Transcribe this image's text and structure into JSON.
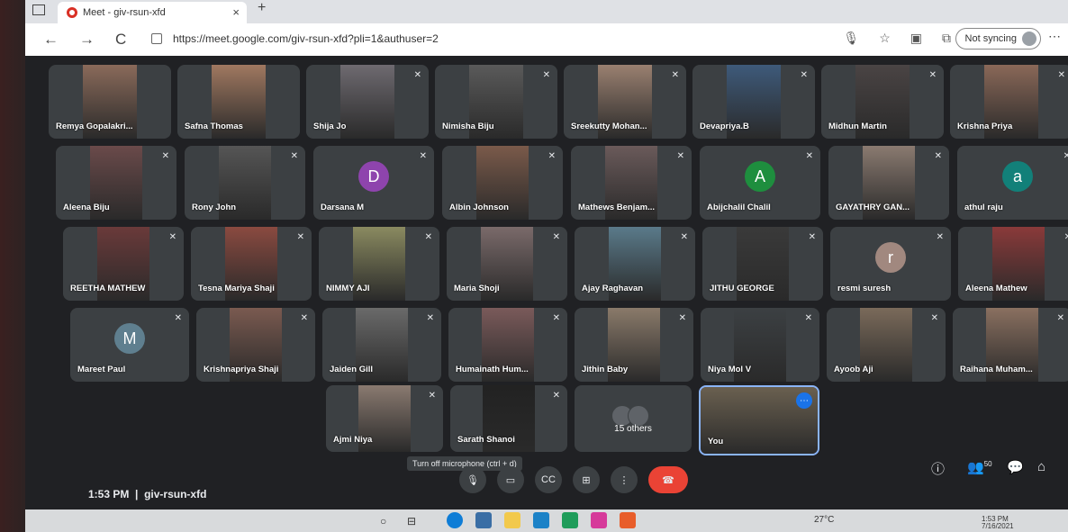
{
  "browser": {
    "tab_title": "Meet - giv-rsun-xfd",
    "tab_close": "×",
    "new_tab": "+",
    "url": "https://meet.google.com/giv-rsun-xfd?pli=1&authuser=2",
    "sync_label": "Not syncing",
    "back": "←",
    "forward": "→",
    "reload": "C"
  },
  "participants": [
    {
      "name": "Remya Gopalakri...",
      "muted": false,
      "photo": "#8a6a5a"
    },
    {
      "name": "Safna Thomas",
      "muted": false,
      "photo": "#a07860"
    },
    {
      "name": "Shija Jo",
      "muted": true,
      "photo": "#6e6a70"
    },
    {
      "name": "Nimisha Biju",
      "muted": true,
      "photo": "#5a5a5a"
    },
    {
      "name": "Sreekutty Mohan...",
      "muted": true,
      "photo": "#9a8070"
    },
    {
      "name": "Devapriya.B",
      "muted": true,
      "photo": "#3e5a7a"
    },
    {
      "name": "Midhun Martin",
      "muted": true,
      "photo": "#4a4444"
    },
    {
      "name": "Krishna Priya",
      "muted": true,
      "photo": "#8a6858"
    },
    {
      "name": "Aleena Biju",
      "muted": true,
      "photo": "#6a4a4a"
    },
    {
      "name": "Rony John",
      "muted": true,
      "photo": "#555"
    },
    {
      "name": "Darsana M",
      "muted": true,
      "avatar": "D",
      "avatar_color": "#8e44ad"
    },
    {
      "name": "Albin Johnson",
      "muted": true,
      "photo": "#7a5a4a"
    },
    {
      "name": "Mathews Benjam...",
      "muted": true,
      "photo": "#6a5a5a"
    },
    {
      "name": "Abijchalil Chalil",
      "muted": true,
      "avatar": "A",
      "avatar_color": "#1e8e3e"
    },
    {
      "name": "GAYATHRY GAN...",
      "muted": true,
      "photo": "#8a7a70"
    },
    {
      "name": "athul raju",
      "muted": true,
      "avatar": "a",
      "avatar_color": "#128079"
    },
    {
      "name": "REETHA MATHEW",
      "muted": true,
      "photo": "#6a3a3a"
    },
    {
      "name": "Tesna Mariya Shaji",
      "muted": true,
      "photo": "#8a4a40"
    },
    {
      "name": "NIMMY AJI",
      "muted": true,
      "photo": "#8a8a60"
    },
    {
      "name": "Maria Shoji",
      "muted": true,
      "photo": "#7a6a6a"
    },
    {
      "name": "Ajay Raghavan",
      "muted": true,
      "photo": "#5a7a8a"
    },
    {
      "name": "JITHU GEORGE",
      "muted": true,
      "photo": "#3a3a3a"
    },
    {
      "name": "resmi suresh",
      "muted": true,
      "avatar": "r",
      "avatar_color": "#a1887f"
    },
    {
      "name": "Aleena Mathew",
      "muted": true,
      "photo": "#8a3a3a"
    },
    {
      "name": "Mareet Paul",
      "muted": true,
      "avatar": "M",
      "avatar_color": "#5f7f8f"
    },
    {
      "name": "Krishnapriya Shaji",
      "muted": true,
      "photo": "#7a5a50"
    },
    {
      "name": "Jaiden Gill",
      "muted": true,
      "photo": "#6a6a6a"
    },
    {
      "name": "Humainath Hum...",
      "muted": true,
      "photo": "#7a5a5a"
    },
    {
      "name": "Jithin Baby",
      "muted": true,
      "photo": "#8a7a6a"
    },
    {
      "name": "Niya Mol V",
      "muted": true,
      "photo": "#3c4043"
    },
    {
      "name": "Ayoob Aji",
      "muted": true,
      "photo": "#7a6a5a"
    },
    {
      "name": "Raihana Muham...",
      "muted": true,
      "photo": "#8a7060"
    },
    {
      "name": "Ajmi Niya",
      "muted": true,
      "photo": "#8a7a70"
    },
    {
      "name": "Sarath Shanoi",
      "muted": true,
      "photo": "#222"
    },
    {
      "name": "15 others",
      "muted": false,
      "others": true
    },
    {
      "name": "You",
      "muted": false,
      "self": true,
      "photo": "#6a6050"
    }
  ],
  "meeting": {
    "time": "1:53 PM",
    "separator": "|",
    "code": "giv-rsun-xfd",
    "tooltip": "Turn off microphone (ctrl + d)",
    "controls": [
      "mic-icon",
      "camera-icon",
      "captions-icon",
      "present-icon",
      "more-options-icon",
      "end-call-icon"
    ],
    "right_controls": [
      "info-icon",
      "people-icon",
      "chat-icon",
      "activities-icon"
    ],
    "people_count": "50",
    "cc_label": "CC"
  },
  "taskbar": {
    "temperature": "27°C",
    "clock": "1:53 PM",
    "date": "7/16/2021"
  },
  "colors": {
    "meet_bg": "#202124",
    "tile_bg": "#3c4043",
    "end_call": "#ea4335",
    "self_border": "#8ab4f8"
  }
}
